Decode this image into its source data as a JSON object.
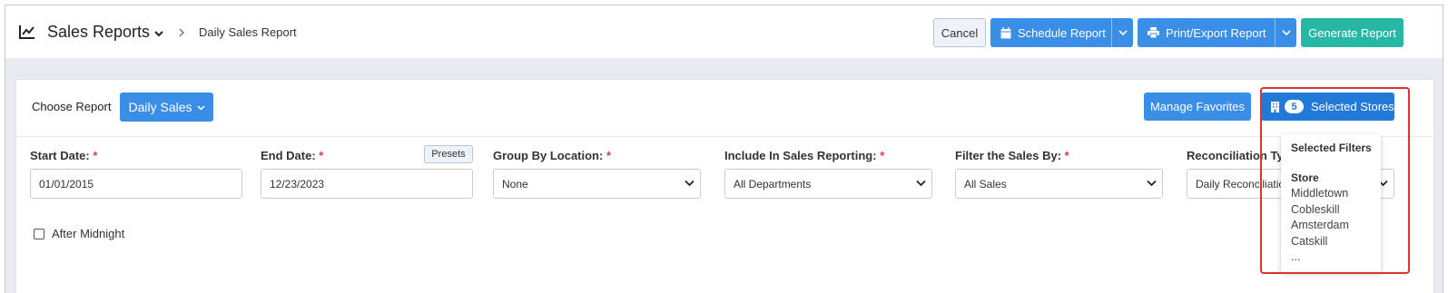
{
  "header": {
    "title": "Sales Reports",
    "breadcrumb": "Daily Sales Report",
    "cancel_label": "Cancel",
    "schedule_label": "Schedule Report",
    "print_label": "Print/Export Report",
    "generate_label": "Generate Report"
  },
  "toolbar": {
    "choose_label": "Choose Report",
    "report_value": "Daily Sales",
    "favorites_label": "Manage Favorites",
    "store_count": "5",
    "stores_label": "Selected Stores"
  },
  "fields": {
    "start_date": {
      "label": "Start Date:",
      "required": "*",
      "value": "01/01/2015"
    },
    "end_date": {
      "label": "End Date:",
      "required": "*",
      "value": "12/23/2023",
      "presets_label": "Presets"
    },
    "group_by": {
      "label": "Group By Location:",
      "required": "*",
      "value": "None"
    },
    "include": {
      "label": "Include In Sales Reporting:",
      "required": "*",
      "value": "All Departments"
    },
    "filter_by": {
      "label": "Filter the Sales By:",
      "required": "*",
      "value": "All Sales"
    },
    "reconciliation": {
      "label": "Reconciliation Type:",
      "value": "Daily Reconciliation"
    }
  },
  "after_midnight_label": "After Midnight",
  "filters_popup": {
    "title": "Selected Filters",
    "store_heading": "Store",
    "stores": [
      "Middletown",
      "Cobleskill",
      "Amsterdam",
      "Catskill",
      "..."
    ]
  },
  "colors": {
    "primary": "#3a8ee6",
    "primary_dark": "#2279d8",
    "teal": "#27b8a5",
    "required": "#e23b3b",
    "highlight": "#e03131"
  }
}
